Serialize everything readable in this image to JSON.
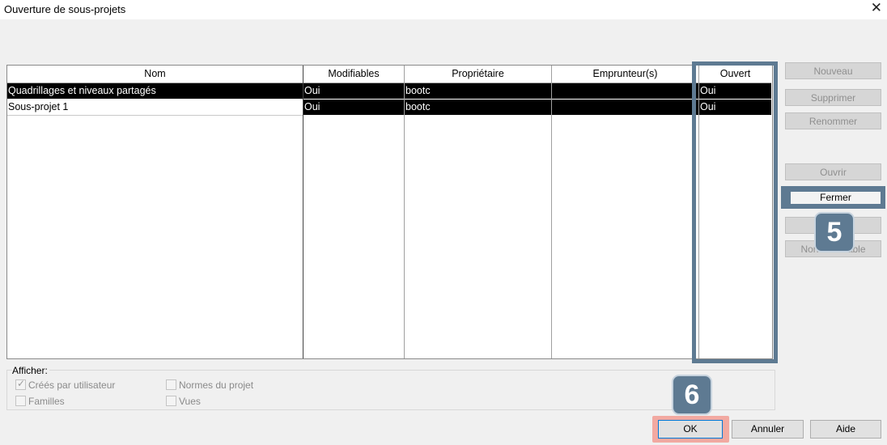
{
  "window": {
    "title": "Ouverture de sous-projets",
    "close_glyph": "✕"
  },
  "table": {
    "headers": {
      "name": "Nom",
      "editable": "Modifiables",
      "owner": "Propriétaire",
      "borrowers": "Emprunteur(s)",
      "opened": "Ouvert"
    },
    "rows": [
      {
        "name": "Quadrillages et niveaux partagés",
        "editable": "Oui",
        "owner": "bootc",
        "borrowers": "",
        "opened": "Oui"
      },
      {
        "name": "Sous-projet 1",
        "editable": "Oui",
        "owner": "bootc",
        "borrowers": "",
        "opened": "Oui"
      }
    ]
  },
  "side_buttons": {
    "nouveau": "Nouveau",
    "supprimer": "Supprimer",
    "renommer": "Renommer",
    "ouvrir": "Ouvrir",
    "fermer": "Fermer",
    "non_modifiable": "Non modifiable"
  },
  "afficher": {
    "title": "Afficher:",
    "options": {
      "crees": {
        "label": "Créés par utilisateur",
        "checked": true
      },
      "normes": {
        "label": "Normes du projet",
        "checked": false
      },
      "familles": {
        "label": "Familles",
        "checked": false
      },
      "vues": {
        "label": "Vues",
        "checked": false
      }
    }
  },
  "buttons": {
    "ok": "OK",
    "annuler": "Annuler",
    "aide": "Aide"
  },
  "annotations": {
    "step5": "5",
    "step6": "6"
  },
  "colors": {
    "annotation_blue": "#5e7a92",
    "annotation_red": "#f2a9a1",
    "selection": "#000000"
  }
}
